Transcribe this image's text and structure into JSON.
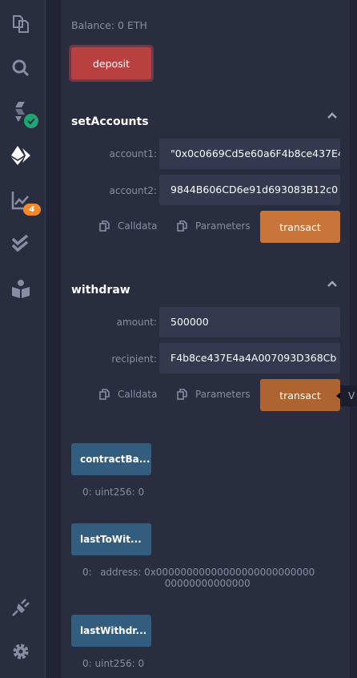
{
  "sidebar": {
    "icons": [
      "file-explorer-icon",
      "search-icon",
      "solidity-compiler-icon",
      "deploy-run-icon",
      "analysis-icon",
      "testing-icon",
      "learneth-icon",
      "plugin-manager-icon",
      "settings-icon"
    ],
    "analysis_badge": "4"
  },
  "balance": "Balance: 0 ETH",
  "deposit": {
    "label": "deposit",
    "color": "#b84040"
  },
  "setAccounts": {
    "title": "setAccounts",
    "params": [
      {
        "label": "account1:",
        "value": "\"0x0c0669Cd5e60a6F4b8ce437E4"
      },
      {
        "label": "account2:",
        "value": "9844B606CD6e91d693083B12c0"
      }
    ],
    "calldata": "Calldata",
    "parameters": "Parameters",
    "transact": "transact"
  },
  "withdraw": {
    "title": "withdraw",
    "params": [
      {
        "label": "amount:",
        "value": "500000"
      },
      {
        "label": "recipient:",
        "value": "F4b8ce437E4a4A007093D368Cb"
      }
    ],
    "calldata": "Calldata",
    "parameters": "Parameters",
    "transact": "transact",
    "tooltip": "V"
  },
  "calls": [
    {
      "label": "contractBa...",
      "output_index": "0:",
      "output": "uint256: 0"
    },
    {
      "label": "lastToWit...",
      "output_index": "0:",
      "output": "address: 0x0000000000000000000000000000000000000000"
    },
    {
      "label": "lastWithdr...",
      "output_index": "0:",
      "output": "uint256: 0"
    }
  ],
  "colors": {
    "transact": "#c97539",
    "call": "#325d7e",
    "success_badge": "#1ea672",
    "warning_badge": "#f28b2b"
  }
}
